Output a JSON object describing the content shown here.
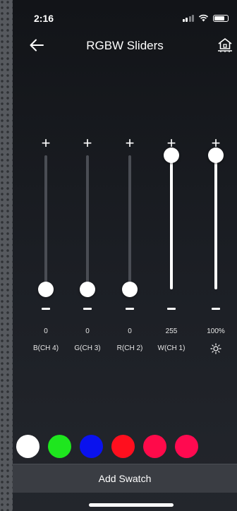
{
  "status_bar": {
    "time": "2:16"
  },
  "header": {
    "title": "RGBW Sliders",
    "back_icon": "arrow-left-icon",
    "home_icon": "home-icon"
  },
  "sliders": [
    {
      "label": "B(CH 4)",
      "value_text": "0",
      "level": 0.0
    },
    {
      "label": "G(CH 3)",
      "value_text": "0",
      "level": 0.0
    },
    {
      "label": "R(CH 2)",
      "value_text": "0",
      "level": 0.0
    },
    {
      "label": "W(CH 1)",
      "value_text": "255",
      "level": 1.0
    },
    {
      "label": "",
      "value_text": "100%",
      "level": 1.0,
      "icon": "sun-icon"
    }
  ],
  "swatches": [
    {
      "color": "#ffffff"
    },
    {
      "color": "#1ee61e"
    },
    {
      "color": "#0a12ee"
    },
    {
      "color": "#ff0f1e"
    },
    {
      "color": "#ff0a4a"
    },
    {
      "color": "#ff0a50"
    }
  ],
  "footer": {
    "add_swatch_label": "Add Swatch"
  },
  "colors": {
    "background": "#16181d",
    "track": "#4a4d54",
    "bar": "#3a3d43"
  }
}
